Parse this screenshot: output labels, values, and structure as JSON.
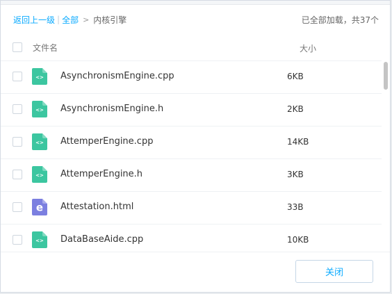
{
  "breadcrumb": {
    "back_label": "返回上一级",
    "separator": "|",
    "all_label": "全部",
    "arrow": ">",
    "current_label": "内核引擎"
  },
  "status": {
    "loaded_text": "已全部加载，共37个"
  },
  "header": {
    "name_label": "文件名",
    "size_label": "大小"
  },
  "files": [
    {
      "name": "AsynchronismEngine.cpp",
      "size": "6KB",
      "icon": "code-file-icon",
      "color": "#3cc6a0",
      "glyph": "<>"
    },
    {
      "name": "AsynchronismEngine.h",
      "size": "2KB",
      "icon": "code-file-icon",
      "color": "#3cc6a0",
      "glyph": "<>"
    },
    {
      "name": "AttemperEngine.cpp",
      "size": "14KB",
      "icon": "code-file-icon",
      "color": "#3cc6a0",
      "glyph": "<>"
    },
    {
      "name": "AttemperEngine.h",
      "size": "3KB",
      "icon": "code-file-icon",
      "color": "#3cc6a0",
      "glyph": "<>"
    },
    {
      "name": "Attestation.html",
      "size": "33B",
      "icon": "html-file-icon",
      "color": "#7b7fe0",
      "glyph": "e"
    },
    {
      "name": "DataBaseAide.cpp",
      "size": "10KB",
      "icon": "code-file-icon",
      "color": "#3cc6a0",
      "glyph": "<>"
    }
  ],
  "footer": {
    "close_label": "关闭"
  },
  "colors": {
    "link": "#09aaff",
    "code_icon": "#3cc6a0",
    "html_icon": "#7b7fe0"
  }
}
